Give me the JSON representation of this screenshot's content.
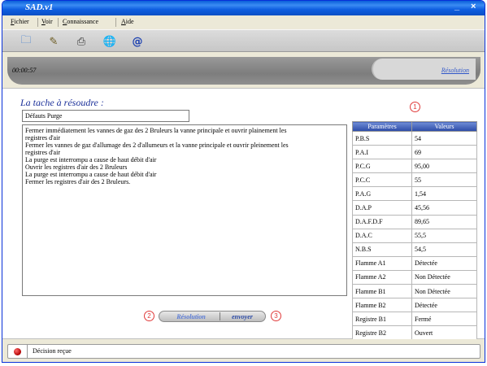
{
  "window": {
    "title": "SAD.v1",
    "minimize_glyph": "_",
    "close_glyph": "×"
  },
  "menu": [
    "Fichier",
    "Voir",
    "Connaissance",
    "Aide"
  ],
  "toolbar": [
    {
      "icon": "open-icon",
      "glyph": "🗀"
    },
    {
      "icon": "knowledge-icon",
      "glyph": "✎"
    },
    {
      "icon": "print-icon",
      "glyph": "⎙"
    },
    {
      "icon": "globe-icon",
      "glyph": "🌐"
    },
    {
      "icon": "email-icon",
      "glyph": "@"
    }
  ],
  "header": {
    "timer": "00:00:57",
    "tab_label": "Résolution"
  },
  "task": {
    "heading": "La tache à résoudre :",
    "name": "Défauts Purge",
    "steps": [
      "Fermer immédiatement les vannes de gaz des 2 Bruleurs la vanne principale et ouvrir plainement les",
      "registres d'air",
      "Fermer les vannes de gaz d'allumage des 2 d'allumeurs et la vanne principale et ouvrir pleinement les",
      "registres d'air",
      "La purge est interrompu a cause de haut débit d'air",
      "Ouvrir les registres d'air des 2 Bruleurs",
      "La purge est interrompu a cause de haut débit d'air",
      "Fermer les registres d'air des 2 Bruleurs."
    ]
  },
  "markers": {
    "one": "1",
    "two": "2",
    "three": "3"
  },
  "buttons": {
    "resolution": "Résolution",
    "envoyer": "envoyer"
  },
  "params_table": {
    "headers": [
      "Paramètres",
      "Valeurs"
    ],
    "rows": [
      [
        "P.B.S",
        "54"
      ],
      [
        "P.A.I",
        "69"
      ],
      [
        "P.C.G",
        "95,00"
      ],
      [
        "P.C.C",
        "55"
      ],
      [
        "P.A.G",
        "1,54"
      ],
      [
        "D.A.P",
        "45,56"
      ],
      [
        "D.A.F.D.F",
        "89,65"
      ],
      [
        "D.A.C",
        "55,5"
      ],
      [
        "N.B.S",
        "54,5"
      ],
      [
        "Flamme A1",
        "Détectée"
      ],
      [
        "Flamme A2",
        "Non Détectée"
      ],
      [
        "Flamme B1",
        "Non Détectée"
      ],
      [
        "Flamme B2",
        "Détectée"
      ],
      [
        "Registre B1",
        "Fermé"
      ],
      [
        "Registre B2",
        "Ouvert"
      ]
    ]
  },
  "statusbar": {
    "message": "Décision reçue",
    "indicator_color": "#c00000"
  }
}
